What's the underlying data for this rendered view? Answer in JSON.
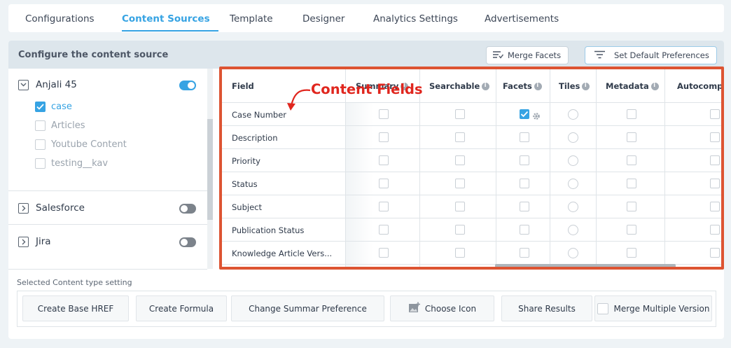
{
  "tabs": [
    {
      "label": "Configurations"
    },
    {
      "label": "Content Sources"
    },
    {
      "label": "Template"
    },
    {
      "label": "Designer"
    },
    {
      "label": "Analytics Settings"
    },
    {
      "label": "Advertisements"
    }
  ],
  "active_tab": "Content Sources",
  "config_bar": {
    "title": "Configure the content source",
    "merge_facets_label": "Merge Facets",
    "set_default_label": "Set Default Preferences"
  },
  "annotation": {
    "text": "Content Fields",
    "color": "#e0261e"
  },
  "sources": [
    {
      "name": "Anjali 45",
      "expanded": true,
      "enabled": true,
      "content_types": [
        {
          "label": "case",
          "checked": true
        },
        {
          "label": "Articles",
          "checked": false
        },
        {
          "label": "Youtube Content",
          "checked": false
        },
        {
          "label": "testing__kav",
          "checked": false
        }
      ]
    },
    {
      "name": "Salesforce",
      "expanded": false,
      "enabled": false
    },
    {
      "name": "Jira",
      "expanded": false,
      "enabled": false
    }
  ],
  "table": {
    "columns": [
      {
        "label": "Field"
      },
      {
        "label": "Summary"
      },
      {
        "label": "Searchable"
      },
      {
        "label": "Facets"
      },
      {
        "label": "Tiles"
      },
      {
        "label": "Metadata"
      },
      {
        "label": "Autocomplete"
      }
    ],
    "rows": [
      {
        "field": "Case Number",
        "facets_checked": true
      },
      {
        "field": "Description",
        "facets_checked": false
      },
      {
        "field": "Priority",
        "facets_checked": false
      },
      {
        "field": "Status",
        "facets_checked": false
      },
      {
        "field": "Subject",
        "facets_checked": false
      },
      {
        "field": "Publication Status",
        "facets_checked": false
      },
      {
        "field": "Knowledge Article Vers..."
      }
    ]
  },
  "content_type_setting": {
    "label": "Selected Content type setting",
    "actions": [
      {
        "label": "Create Base HREF"
      },
      {
        "label": "Create Formula"
      },
      {
        "label": "Change Summar Preference"
      },
      {
        "label": "Choose Icon"
      },
      {
        "label": "Share Results"
      },
      {
        "label": "Merge Multiple Version",
        "checked": false
      }
    ]
  },
  "colors": {
    "accent": "#36a3e3",
    "highlight_border": "#dd5432",
    "annotation": "#e0261e"
  }
}
